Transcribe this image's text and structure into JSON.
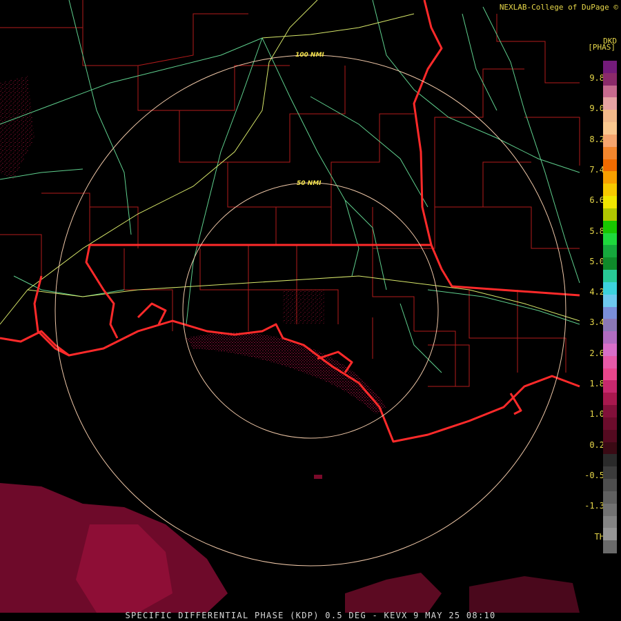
{
  "header": {
    "credit": "NEXLAB-College of DuPage ©",
    "product": "DKD",
    "units": "[PHAS]"
  },
  "footer": {
    "caption": "SPECIFIC DIFFERENTIAL PHASE (KDP) 0.5 DEG - KEVX 9 MAY 25 08:10"
  },
  "range_rings": [
    {
      "label": "50 NMI"
    },
    {
      "label": "100 NMI"
    }
  ],
  "color_scale": {
    "labels": [
      "9.8",
      "9.0",
      "8.2",
      "7.4",
      "6.6",
      "5.8",
      "5.0",
      "4.2",
      "3.4",
      "2.6",
      "1.8",
      "1.0",
      "0.2",
      "-0.5",
      "-1.3",
      "TH"
    ],
    "colors": [
      "#741b7a",
      "#8b2a6a",
      "#c76a8e",
      "#e6a3a3",
      "#f2b98a",
      "#fbc88f",
      "#f6a56e",
      "#f3862d",
      "#f06b00",
      "#f7a000",
      "#f6c800",
      "#f0e600",
      "#b0c600",
      "#18c600",
      "#1ed83c",
      "#16a83c",
      "#0f8a2a",
      "#28c896",
      "#3cd2dc",
      "#6ec8ee",
      "#7a8ed8",
      "#8a78b6",
      "#b06cc0",
      "#d86ec8",
      "#e65aa8",
      "#e8468c",
      "#c8286e",
      "#a8184e",
      "#82103a",
      "#6c0c2c",
      "#540a20",
      "#3a0a14",
      "#2a2a2a",
      "#3c3c3c",
      "#4e4e4e",
      "#606060",
      "#727272",
      "#848484",
      "#969696",
      "#6a6a6a"
    ],
    "accent_text": "#e8d84a"
  },
  "map_colors": {
    "county_lines": "#b31b1b",
    "state_lines": "#ff2a2a",
    "highways_major": "#d8e86a",
    "highways_minor": "#5fd08e",
    "range_rings": "#f0c8a8",
    "echo": "#7a0a2a"
  }
}
